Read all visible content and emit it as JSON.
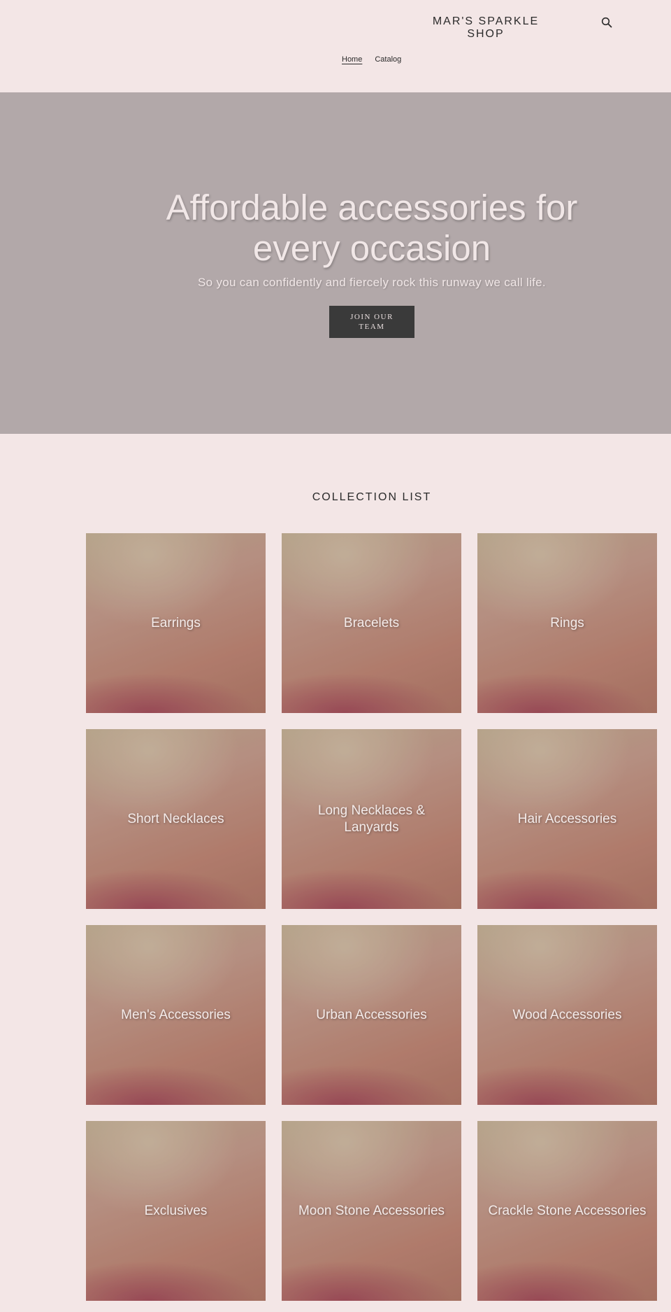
{
  "header": {
    "logo": "MAR'S SPARKLE SHOP",
    "search_icon": "search-icon",
    "nav": [
      {
        "label": "Home",
        "active": true
      },
      {
        "label": "Catalog",
        "active": false
      }
    ]
  },
  "hero": {
    "title": "Affordable accessories for every occasion",
    "subtitle": "So you can confidently and fiercely rock this runway we call life.",
    "button_label": "JOIN OUR TEAM"
  },
  "collection": {
    "title": "COLLECTION LIST",
    "items": [
      {
        "label": "Earrings"
      },
      {
        "label": "Bracelets"
      },
      {
        "label": "Rings"
      },
      {
        "label": "Short Necklaces"
      },
      {
        "label": "Long Necklaces & Lanyards"
      },
      {
        "label": "Hair Accessories"
      },
      {
        "label": "Men's Accessories"
      },
      {
        "label": "Urban Accessories"
      },
      {
        "label": "Wood Accessories"
      },
      {
        "label": "Exclusives"
      },
      {
        "label": "Moon Stone Accessories"
      },
      {
        "label": "Crackle Stone Accessories"
      }
    ]
  },
  "colors": {
    "page_background": "#f3e6e6",
    "hero_background": "#b2a8a9",
    "button_background": "#3a3a3a",
    "text_light": "#f1e7e7"
  }
}
